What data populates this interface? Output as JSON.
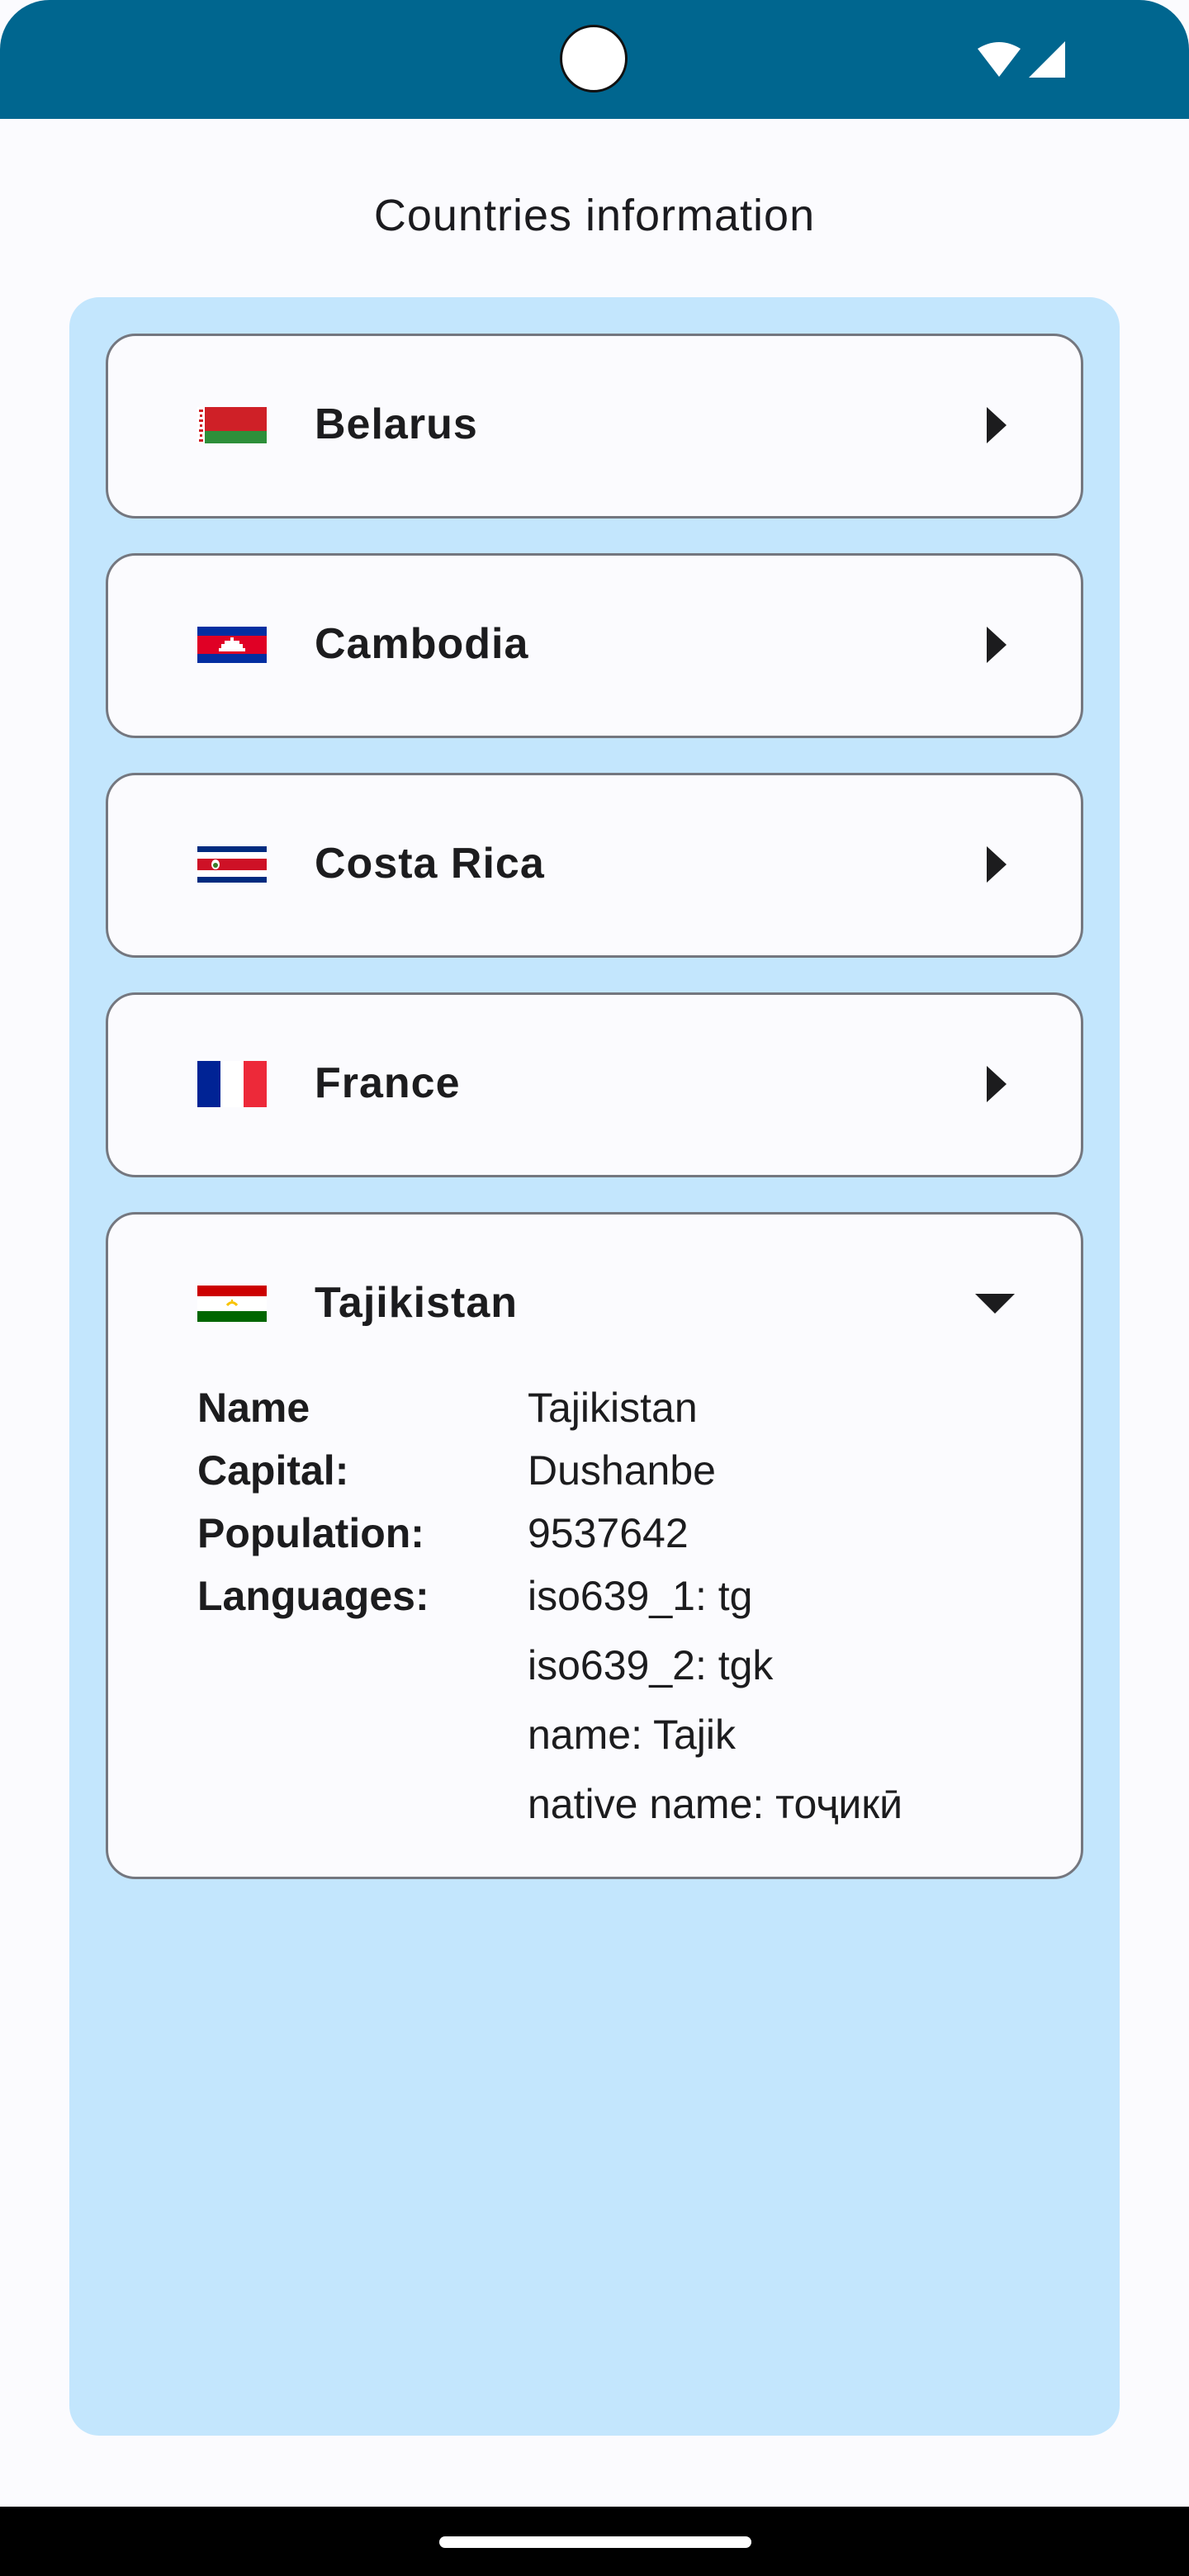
{
  "app": {
    "title": "Countries information"
  },
  "colors": {
    "status_bar": "#00668f",
    "panel": "#c3e6fd",
    "card_background": "#fbfbfe",
    "card_border": "#74777f"
  },
  "status_bar": {
    "icons": [
      "wifi-icon",
      "cellular-signal-icon"
    ]
  },
  "countries": [
    {
      "name": "Belarus",
      "flag": "belarus-flag-icon",
      "expanded": false,
      "chevron": "chevron-right-icon"
    },
    {
      "name": "Cambodia",
      "flag": "cambodia-flag-icon",
      "expanded": false,
      "chevron": "chevron-right-icon"
    },
    {
      "name": "Costa Rica",
      "flag": "costa-rica-flag-icon",
      "expanded": false,
      "chevron": "chevron-right-icon"
    },
    {
      "name": "France",
      "flag": "france-flag-icon",
      "expanded": false,
      "chevron": "chevron-right-icon"
    },
    {
      "name": "Tajikistan",
      "flag": "tajikistan-flag-icon",
      "expanded": true,
      "chevron": "chevron-down-icon",
      "details": {
        "name_label": "Name",
        "name_value": "Tajikistan",
        "capital_label": "Capital:",
        "capital_value": "Dushanbe",
        "population_label": "Population:",
        "population_value": "9537642",
        "languages_label": "Languages:",
        "languages": [
          "iso639_1: tg",
          "iso639_2: tgk",
          "name: Tajik",
          "native name: тоҷикӣ"
        ]
      }
    }
  ]
}
